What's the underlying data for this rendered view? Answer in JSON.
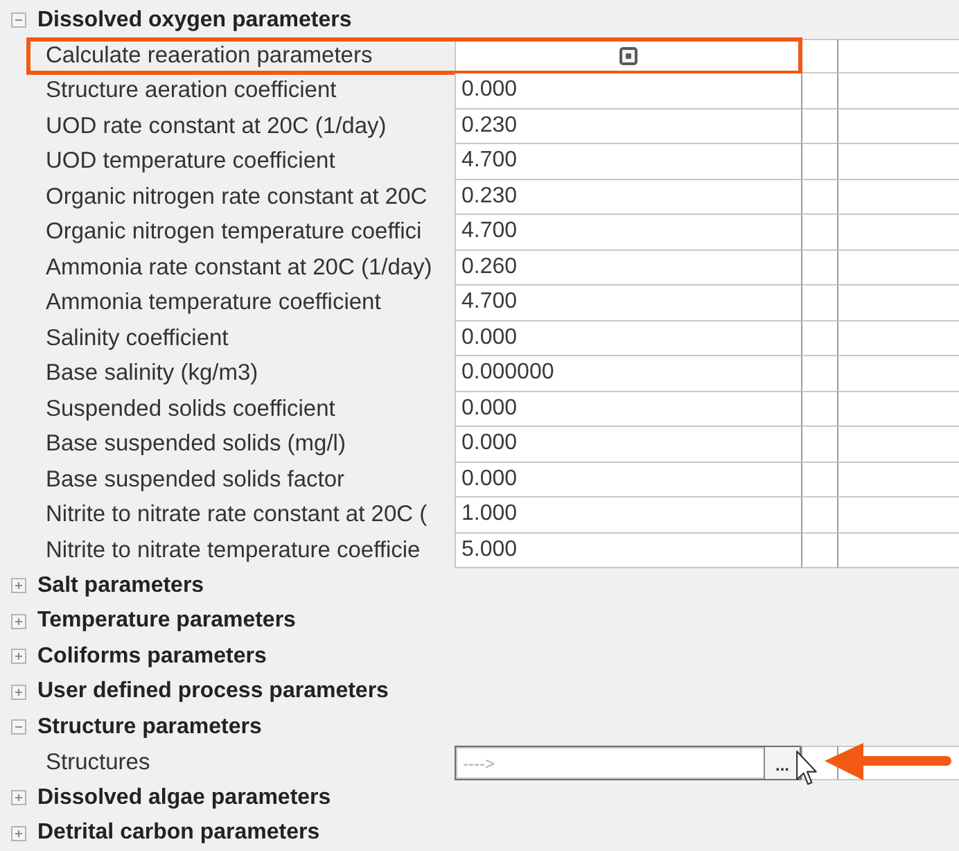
{
  "groups": [
    {
      "title": "Dissolved oxygen parameters",
      "expanded": true,
      "properties": [
        {
          "kind": "checkbox",
          "label": "Calculate reaeration parameters",
          "checked": true,
          "highlighted": true,
          "pointed": false,
          "hovered": false
        },
        {
          "kind": "number",
          "label": "Structure aeration coefficient",
          "value": "0.000",
          "highlighted": false,
          "pointed": false,
          "hovered": false
        },
        {
          "kind": "number",
          "label": "UOD rate constant at 20C (1/day)",
          "value": "0.230",
          "highlighted": false,
          "pointed": false,
          "hovered": false
        },
        {
          "kind": "number",
          "label": "UOD temperature coefficient",
          "value": "4.700",
          "highlighted": false,
          "pointed": false,
          "hovered": false
        },
        {
          "kind": "number",
          "label": "Organic nitrogen rate constant at 20C",
          "value": "0.230",
          "highlighted": false,
          "pointed": false,
          "hovered": false
        },
        {
          "kind": "number",
          "label": "Organic nitrogen temperature coeffici",
          "value": "4.700",
          "highlighted": false,
          "pointed": false,
          "hovered": false
        },
        {
          "kind": "number",
          "label": "Ammonia rate constant at 20C (1/day)",
          "value": "0.260",
          "highlighted": false,
          "pointed": false,
          "hovered": false
        },
        {
          "kind": "number",
          "label": "Ammonia temperature coefficient",
          "value": "4.700",
          "highlighted": false,
          "pointed": false,
          "hovered": false
        },
        {
          "kind": "number",
          "label": "Salinity coefficient",
          "value": "0.000",
          "highlighted": false,
          "pointed": false,
          "hovered": false
        },
        {
          "kind": "number",
          "label": "Base salinity (kg/m3)",
          "value": "0.000000",
          "highlighted": false,
          "pointed": false,
          "hovered": false
        },
        {
          "kind": "number",
          "label": "Suspended solids coefficient",
          "value": "0.000",
          "highlighted": false,
          "pointed": false,
          "hovered": false
        },
        {
          "kind": "number",
          "label": "Base suspended solids (mg/l)",
          "value": "0.000",
          "highlighted": false,
          "pointed": false,
          "hovered": false
        },
        {
          "kind": "number",
          "label": "Base suspended solids factor",
          "value": "0.000",
          "highlighted": false,
          "pointed": false,
          "hovered": false
        },
        {
          "kind": "number",
          "label": "Nitrite to nitrate rate constant at 20C (",
          "value": "1.000",
          "highlighted": false,
          "pointed": false,
          "hovered": false
        },
        {
          "kind": "number",
          "label": "Nitrite to nitrate temperature coefficie",
          "value": "5.000",
          "highlighted": false,
          "pointed": false,
          "hovered": false
        }
      ]
    },
    {
      "title": "Salt parameters",
      "expanded": false
    },
    {
      "title": "Temperature parameters",
      "expanded": false
    },
    {
      "title": "Coliforms parameters",
      "expanded": false
    },
    {
      "title": "User defined process parameters",
      "expanded": false
    },
    {
      "title": "Structure parameters",
      "expanded": true,
      "properties": [
        {
          "kind": "browse",
          "label": "Structures",
          "placeholder": "---->",
          "button": "...",
          "highlighted": false,
          "pointed": true,
          "hovered": true
        }
      ]
    },
    {
      "title": "Dissolved algae parameters",
      "expanded": false
    },
    {
      "title": "Detrital carbon parameters",
      "expanded": false
    }
  ]
}
